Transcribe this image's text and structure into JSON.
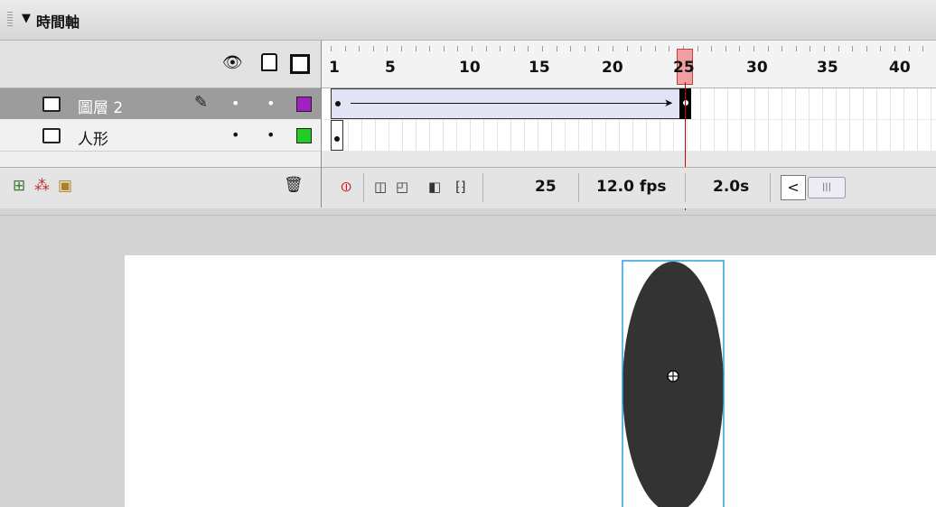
{
  "panel": {
    "title": "時間軸",
    "collapse_icon": "▼"
  },
  "layers": [
    {
      "name": "圖層 2",
      "color": "#a020c0",
      "selected": true
    },
    {
      "name": "人形",
      "color": "#22cc22",
      "selected": false
    }
  ],
  "ruler_labels": [
    "1",
    "5",
    "10",
    "15",
    "20",
    "25",
    "30",
    "35",
    "40"
  ],
  "status": {
    "current_frame": "25",
    "frame_rate": "12.0 fps",
    "elapsed_time": "2.0s"
  },
  "stage": {
    "shape_color": "#333333",
    "selection_color": "#2aa0e0"
  },
  "colors": {
    "playhead": "#cc0000",
    "tween_fill": "#e3e3f6"
  }
}
